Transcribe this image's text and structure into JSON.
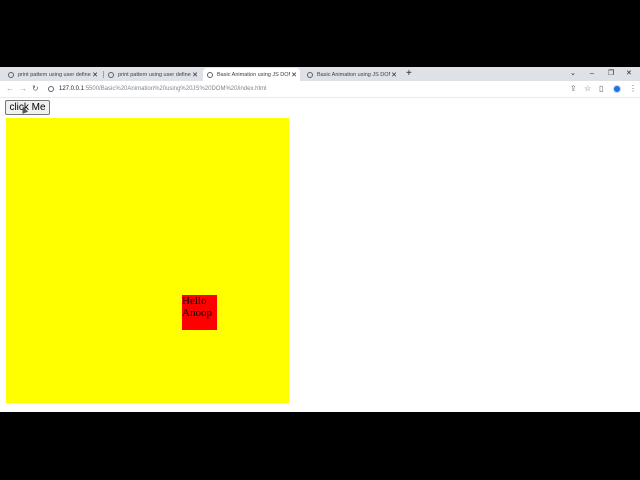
{
  "browser": {
    "tabs": [
      {
        "title": "print pattern using user defined",
        "active": false
      },
      {
        "title": "print pattern using user defined",
        "active": false
      },
      {
        "title": "Basic Animation using JS DOM",
        "active": true
      },
      {
        "title": "Basic Animation using JS DOM",
        "active": false
      }
    ],
    "new_tab_icon": "plus-icon",
    "url": {
      "host": "127.0.0.1",
      "rest": ":5500/Basic%20Animation%20using%20JS%20DOM%20/index.html"
    }
  },
  "page": {
    "button_label": "click Me",
    "box_text": "Hello Anoop",
    "colors": {
      "container": "#ffff00",
      "box": "#ff0000",
      "letterbox": "#000000"
    }
  }
}
